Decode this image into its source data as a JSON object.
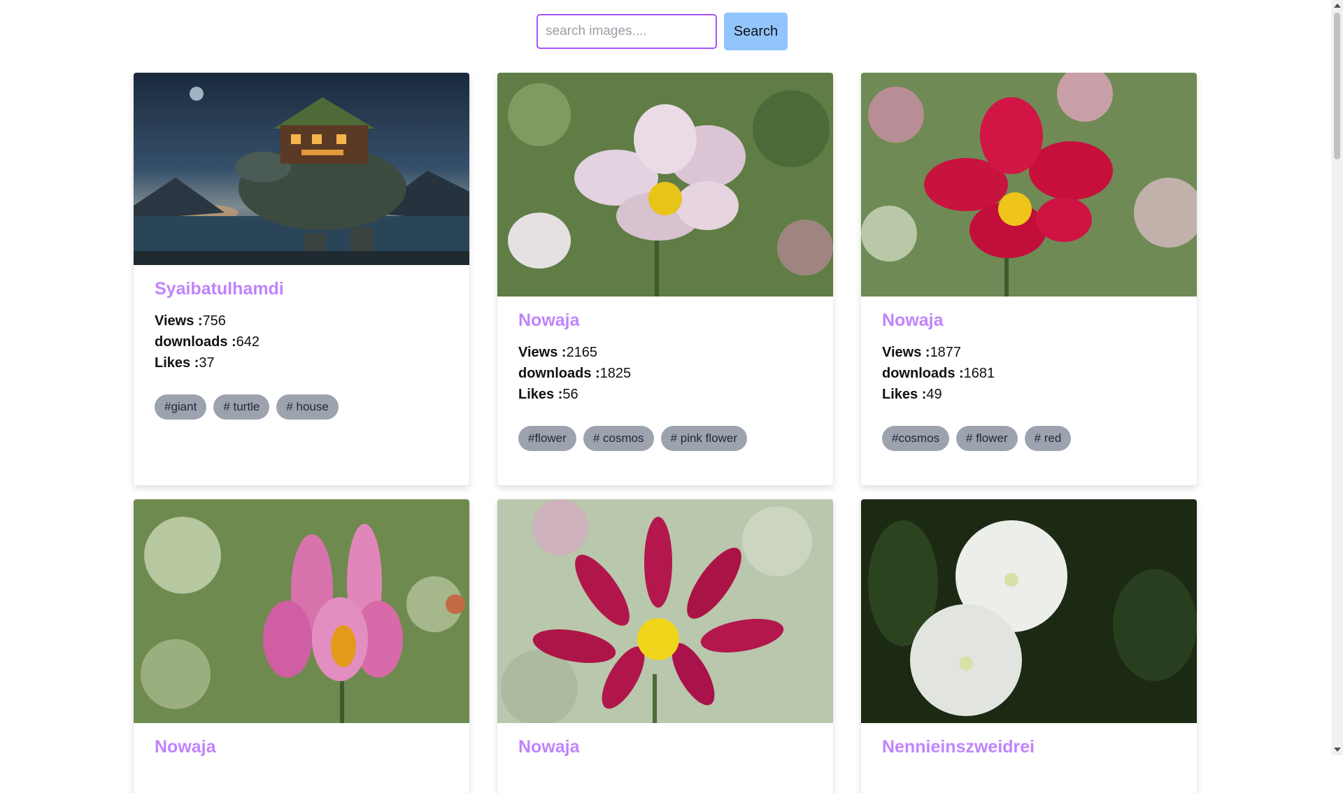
{
  "search": {
    "placeholder": "search images....",
    "value": "",
    "button_label": "Search"
  },
  "labels": {
    "views": "Views :",
    "downloads": "downloads :",
    "likes": "Likes :"
  },
  "cards": [
    {
      "author": "Syaibatulhamdi",
      "views": "756",
      "downloads": "642",
      "likes": "37",
      "tags": [
        "#giant",
        "# turtle",
        "# house"
      ],
      "image": "giant-turtle-house-image"
    },
    {
      "author": "Nowaja",
      "views": "2165",
      "downloads": "1825",
      "likes": "56",
      "tags": [
        "#flower",
        "# cosmos",
        "# pink flower"
      ],
      "image": "pink-cosmos-image"
    },
    {
      "author": "Nowaja",
      "views": "1877",
      "downloads": "1681",
      "likes": "49",
      "tags": [
        "#cosmos",
        "# flower",
        "# red"
      ],
      "image": "red-cosmos-image"
    },
    {
      "author": "Nowaja",
      "image": "pink-cosmos-bud-image"
    },
    {
      "author": "Nowaja",
      "image": "magenta-cosmos-image"
    },
    {
      "author": "Nennieinszweidrei",
      "image": "white-bindweed-image"
    }
  ],
  "colors": {
    "accent": "#c084fc",
    "search_border": "#a855f7",
    "button": "#93c5fd",
    "tag": "#9ca3af"
  }
}
